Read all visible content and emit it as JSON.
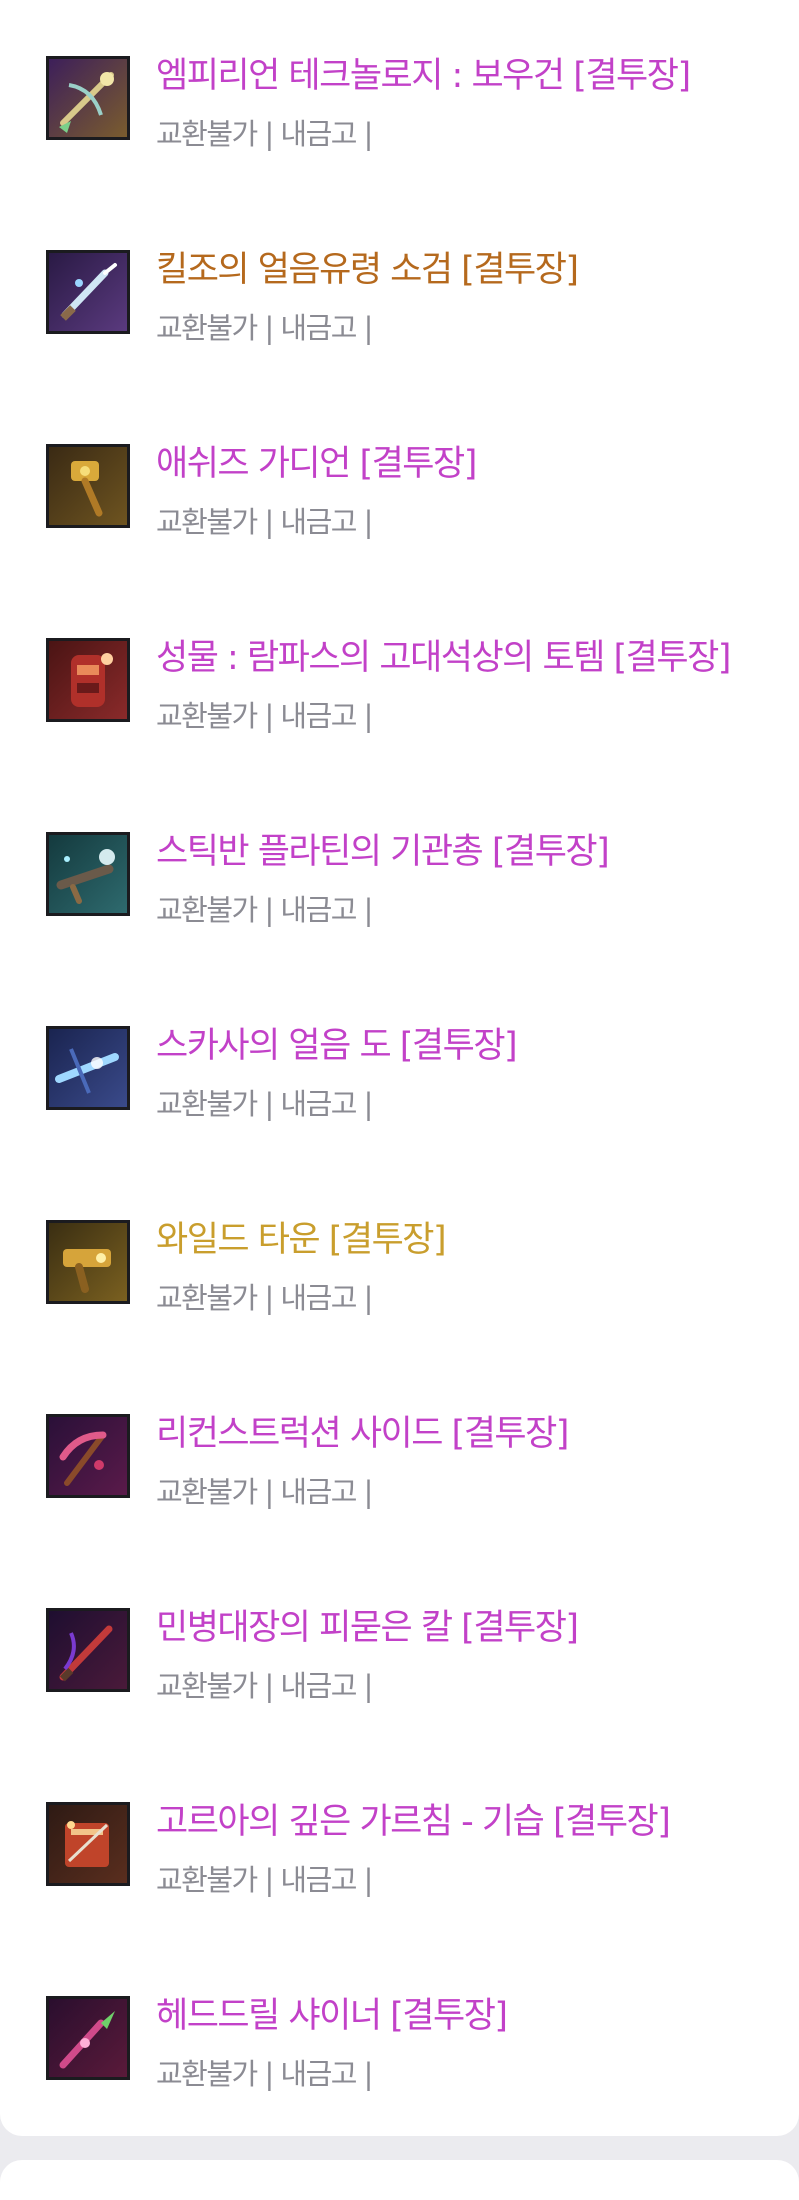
{
  "colors": {
    "epic": "#c241c8",
    "legendary": "#b5691d",
    "mythic": "#c99e2d",
    "meta": "#8b8b93"
  },
  "meta_text": "교환불가 | 내금고 |",
  "items": [
    {
      "name": "엠피리언 테크놀로지 : 보우건 [결투장]",
      "rarity": "epic",
      "icon": "crossbow-icon"
    },
    {
      "name": "킬조의 얼음유령 소검 [결투장]",
      "rarity": "legendary",
      "icon": "ice-dagger-icon"
    },
    {
      "name": "애쉬즈 가디언 [결투장]",
      "rarity": "epic",
      "icon": "golden-hammer-icon"
    },
    {
      "name": "성물 : 람파스의 고대석상의 토템 [결투장]",
      "rarity": "epic",
      "icon": "totem-icon"
    },
    {
      "name": "스틱반 플라틴의 기관총 [결투장]",
      "rarity": "epic",
      "icon": "machine-gun-icon"
    },
    {
      "name": "스카사의 얼음 도 [결투장]",
      "rarity": "epic",
      "icon": "ice-blade-icon"
    },
    {
      "name": "와일드 타운 [결투장]",
      "rarity": "mythic",
      "icon": "golden-gun-icon"
    },
    {
      "name": "리컨스트럭션 사이드 [결투장]",
      "rarity": "epic",
      "icon": "scythe-icon"
    },
    {
      "name": "민병대장의 피묻은 칼 [결투장]",
      "rarity": "epic",
      "icon": "bloody-sword-icon"
    },
    {
      "name": "고르아의 깊은 가르침 - 기습 [결투장]",
      "rarity": "epic",
      "icon": "spellbook-icon"
    },
    {
      "name": "헤드드릴 샤이너 [결투장]",
      "rarity": "epic",
      "icon": "drill-lance-icon"
    }
  ]
}
